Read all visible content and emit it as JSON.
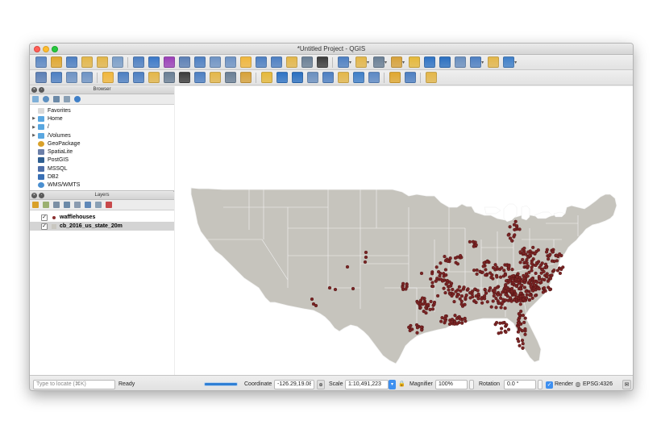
{
  "window": {
    "title": "*Untitled Project - QGIS"
  },
  "browser_panel": {
    "title": "Browser",
    "items": [
      {
        "label": "Favorites",
        "icon": "star-icon",
        "color": "#d9d9d9",
        "expandable": false
      },
      {
        "label": "Home",
        "icon": "folder-icon",
        "color": "#5aa7e0",
        "expandable": true
      },
      {
        "label": "/",
        "icon": "folder-icon",
        "color": "#5aa7e0",
        "expandable": true
      },
      {
        "label": "/Volumes",
        "icon": "folder-icon",
        "color": "#5aa7e0",
        "expandable": true
      },
      {
        "label": "GeoPackage",
        "icon": "geopackage-icon",
        "color": "#d9a12a",
        "expandable": false
      },
      {
        "label": "SpatiaLite",
        "icon": "spatialite-icon",
        "color": "#6b7fa8",
        "expandable": false
      },
      {
        "label": "PostGIS",
        "icon": "postgis-icon",
        "color": "#2f5f91",
        "expandable": false
      },
      {
        "label": "MSSQL",
        "icon": "mssql-icon",
        "color": "#4d6ea8",
        "expandable": false
      },
      {
        "label": "DB2",
        "icon": "db2-icon",
        "color": "#3a70b5",
        "expandable": false
      },
      {
        "label": "WMS/WMTS",
        "icon": "globe-icon",
        "color": "#4a8fd0",
        "expandable": false
      }
    ]
  },
  "layers_panel": {
    "title": "Layers",
    "layers": [
      {
        "name": "wafflehouses",
        "checked": true,
        "symbol_color": "#8b2f2f",
        "selected": false
      },
      {
        "name": "cb_2016_us_state_20m",
        "checked": true,
        "symbol_color": "#c9c7c0",
        "selected": true
      }
    ]
  },
  "map": {
    "land_color": "#c6c4bd",
    "border_color": "#f4f4f4",
    "point_color": "#7a2424",
    "point_outline": "#4a1010"
  },
  "statusbar": {
    "locator_placeholder": "Type to locate (⌘K)",
    "status_text": "Ready",
    "coordinate_label": "Coordinate",
    "coordinate_value": "-126.29,19.08",
    "scale_label": "Scale",
    "scale_value": "1:10,491,223",
    "magnifier_label": "Magnifier",
    "magnifier_value": "100%",
    "rotation_label": "Rotation",
    "rotation_value": "0.0 °",
    "render_label": "Render",
    "render_checked": true,
    "crs": "EPSG:4326"
  },
  "toolbar_1_icons": [
    "new-project-icon",
    "open-project-icon",
    "save-project-icon",
    "save-as-icon",
    "new-print-layout-icon",
    "layout-manager-icon",
    "pan-icon",
    "pan-to-selection-icon",
    "zoom-in-icon",
    "zoom-out-icon",
    "zoom-full-icon",
    "zoom-to-selection-icon",
    "zoom-to-layer-icon",
    "zoom-native-icon",
    "zoom-last-icon",
    "zoom-next-icon",
    "new-bookmark-icon",
    "show-bookmarks-icon",
    "refresh-icon",
    "identify-icon",
    "select-icon",
    "select-by-value-icon",
    "deselect-icon",
    "open-attribute-table-icon",
    "field-calculator-icon",
    "statistics-icon",
    "sum-icon",
    "measure-icon",
    "annotation-icon",
    "text-annotation-icon"
  ],
  "toolbar_2_icons": [
    "data-source-manager-icon",
    "new-layer-icon",
    "digitize-icon",
    "edit-icon",
    "save-edits-icon",
    "pencil-icon",
    "add-feature-icon",
    "vertex-tool-icon",
    "delete-icon",
    "cut-icon",
    "copy-icon",
    "paste-icon",
    "undo-icon",
    "redo-icon",
    "label-icon",
    "layer-labeling-icon",
    "diagram-icon",
    "pin-label-icon",
    "show-hide-label-icon",
    "move-label-icon",
    "rotate-label-icon",
    "change-label-icon",
    "plugin-icon",
    "python-icon",
    "help-icon"
  ]
}
